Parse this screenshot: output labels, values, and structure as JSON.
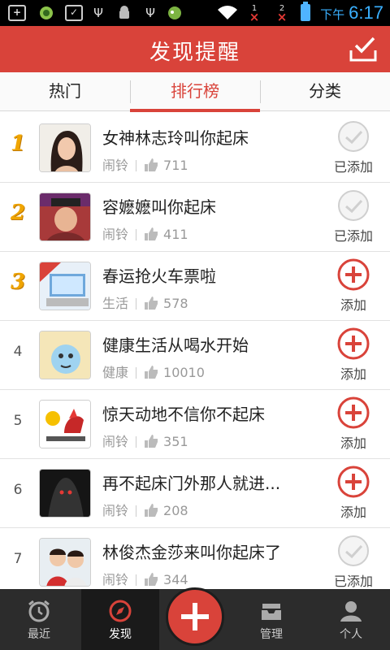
{
  "status_bar": {
    "time_prefix": "下午",
    "time": "6:17",
    "notif_1": "1",
    "notif_2": "2"
  },
  "header": {
    "title": "发现提醒"
  },
  "tabs": [
    {
      "label": "热门",
      "active": false
    },
    {
      "label": "排行榜",
      "active": true
    },
    {
      "label": "分类",
      "active": false
    }
  ],
  "items": [
    {
      "rank": "1",
      "title": "女神林志玲叫你起床",
      "category": "闹铃",
      "likes": "711",
      "action": "已添加",
      "added": true
    },
    {
      "rank": "2",
      "title": "容嬷嬷叫你起床",
      "category": "闹铃",
      "likes": "411",
      "action": "已添加",
      "added": true
    },
    {
      "rank": "3",
      "title": "春运抢火车票啦",
      "category": "生活",
      "likes": "578",
      "action": "添加",
      "added": false
    },
    {
      "rank": "4",
      "title": "健康生活从喝水开始",
      "category": "健康",
      "likes": "10010",
      "action": "添加",
      "added": false
    },
    {
      "rank": "5",
      "title": "惊天动地不信你不起床",
      "category": "闹铃",
      "likes": "351",
      "action": "添加",
      "added": false
    },
    {
      "rank": "6",
      "title": "再不起床门外那人就进...",
      "category": "闹铃",
      "likes": "208",
      "action": "添加",
      "added": false
    },
    {
      "rank": "7",
      "title": "林俊杰金莎来叫你起床了",
      "category": "闹铃",
      "likes": "344",
      "action": "已添加",
      "added": true
    }
  ],
  "bottom_nav": {
    "recent": "最近",
    "discover": "发现",
    "manage": "管理",
    "profile": "个人"
  },
  "colors": {
    "accent": "#d9433a",
    "rank_gold": "#f0a500",
    "nav_bg": "#2c2c2c"
  }
}
